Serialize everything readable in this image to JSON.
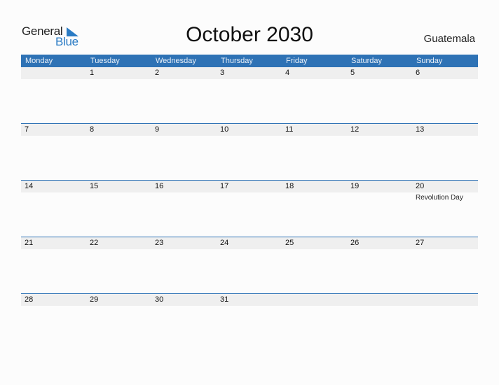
{
  "logo": {
    "word1": "General",
    "word2": "Blue",
    "accent_color": "#2a7bc4"
  },
  "title": "October 2030",
  "country": "Guatemala",
  "colors": {
    "header_bg": "#2e72b5",
    "date_band": "#efefef"
  },
  "weekdays": [
    "Monday",
    "Tuesday",
    "Wednesday",
    "Thursday",
    "Friday",
    "Saturday",
    "Sunday"
  ],
  "weeks": [
    {
      "days": [
        {
          "num": ""
        },
        {
          "num": "1"
        },
        {
          "num": "2"
        },
        {
          "num": "3"
        },
        {
          "num": "4"
        },
        {
          "num": "5"
        },
        {
          "num": "6"
        }
      ]
    },
    {
      "days": [
        {
          "num": "7"
        },
        {
          "num": "8"
        },
        {
          "num": "9"
        },
        {
          "num": "10"
        },
        {
          "num": "11"
        },
        {
          "num": "12"
        },
        {
          "num": "13"
        }
      ]
    },
    {
      "days": [
        {
          "num": "14"
        },
        {
          "num": "15"
        },
        {
          "num": "16"
        },
        {
          "num": "17"
        },
        {
          "num": "18"
        },
        {
          "num": "19"
        },
        {
          "num": "20",
          "holiday": "Revolution Day"
        }
      ]
    },
    {
      "days": [
        {
          "num": "21"
        },
        {
          "num": "22"
        },
        {
          "num": "23"
        },
        {
          "num": "24"
        },
        {
          "num": "25"
        },
        {
          "num": "26"
        },
        {
          "num": "27"
        }
      ]
    },
    {
      "days": [
        {
          "num": "28"
        },
        {
          "num": "29"
        },
        {
          "num": "30"
        },
        {
          "num": "31"
        },
        {
          "num": ""
        },
        {
          "num": ""
        },
        {
          "num": ""
        }
      ]
    }
  ]
}
